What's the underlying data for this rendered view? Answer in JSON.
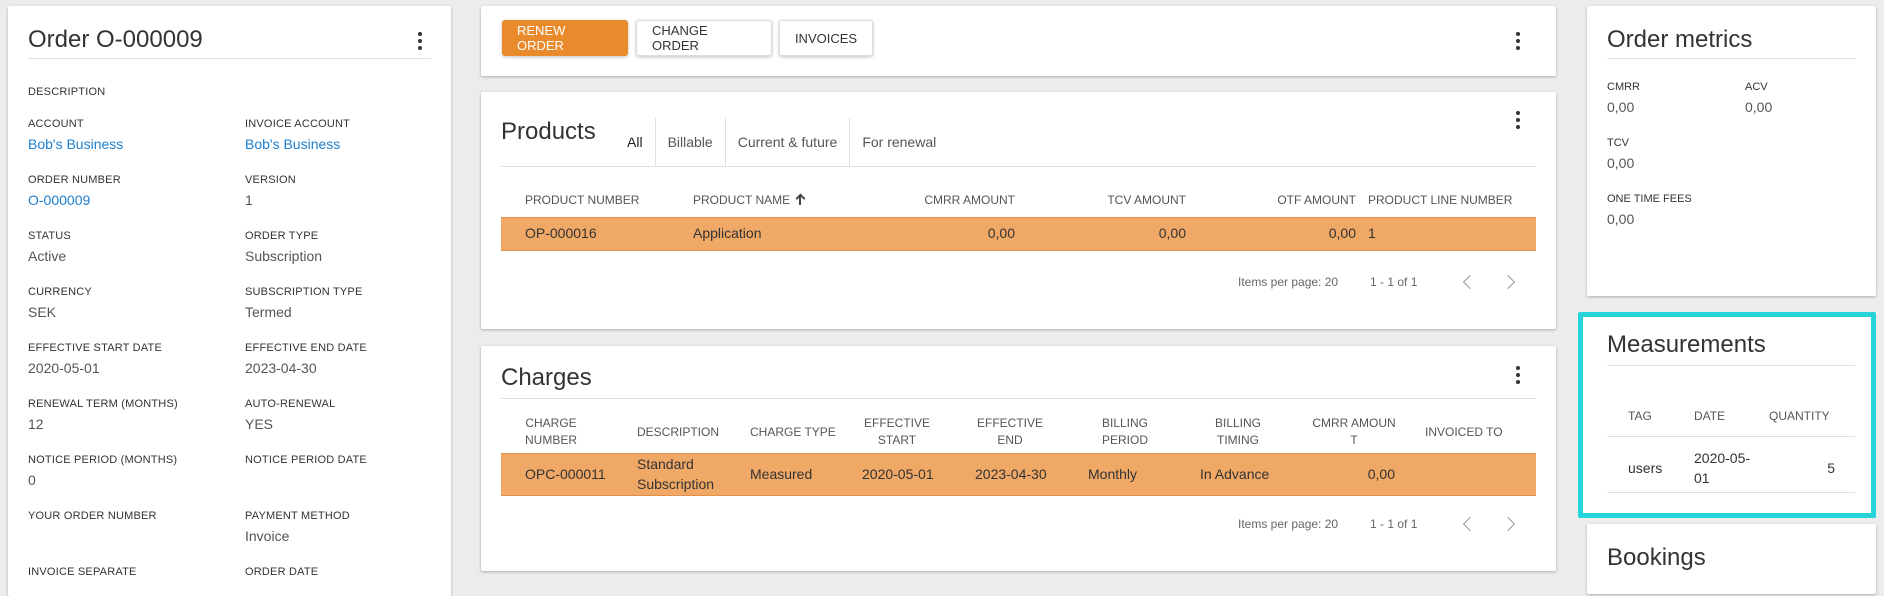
{
  "order": {
    "title": "Order O-000009",
    "fields": {
      "description_label": "DESCRIPTION",
      "account_label": "ACCOUNT",
      "account_value": "Bob's Business",
      "invoice_account_label": "INVOICE ACCOUNT",
      "invoice_account_value": "Bob's Business",
      "order_number_label": "ORDER NUMBER",
      "order_number_value": "O-000009",
      "version_label": "VERSION",
      "version_value": "1",
      "status_label": "STATUS",
      "status_value": "Active",
      "order_type_label": "ORDER TYPE",
      "order_type_value": "Subscription",
      "currency_label": "CURRENCY",
      "currency_value": "SEK",
      "subscription_type_label": "SUBSCRIPTION TYPE",
      "subscription_type_value": "Termed",
      "effective_start_label": "EFFECTIVE START DATE",
      "effective_start_value": "2020-05-01",
      "effective_end_label": "EFFECTIVE END DATE",
      "effective_end_value": "2023-04-30",
      "renewal_term_label": "RENEWAL TERM (MONTHS)",
      "renewal_term_value": "12",
      "auto_renewal_label": "AUTO-RENEWAL",
      "auto_renewal_value": "YES",
      "notice_period_label": "NOTICE PERIOD (MONTHS)",
      "notice_period_value": "0",
      "notice_period_date_label": "NOTICE PERIOD DATE",
      "your_order_number_label": "YOUR ORDER NUMBER",
      "payment_method_label": "PAYMENT METHOD",
      "payment_method_value": "Invoice",
      "invoice_separate_label": "INVOICE SEPARATE",
      "order_date_label": "ORDER DATE"
    }
  },
  "toolbar": {
    "renew_label": "RENEW ORDER",
    "change_label": "CHANGE ORDER",
    "invoices_label": "INVOICES"
  },
  "products": {
    "title": "Products",
    "tabs": [
      "All",
      "Billable",
      "Current & future",
      "For renewal"
    ],
    "columns": [
      "PRODUCT NUMBER",
      "PRODUCT NAME",
      "CMRR AMOUNT",
      "TCV AMOUNT",
      "OTF AMOUNT",
      "PRODUCT LINE NUMBER"
    ],
    "row": [
      "OP-000016",
      "Application",
      "0,00",
      "0,00",
      "0,00",
      "1"
    ],
    "items_per_page": "Items per page: 20",
    "range": "1 - 1 of 1"
  },
  "charges": {
    "title": "Charges",
    "columns": {
      "c1a": "CHARGE",
      "c1b": "NUMBER",
      "c2": "DESCRIPTION",
      "c3": "CHARGE TYPE",
      "c4a": "EFFECTIVE",
      "c4b": "START",
      "c5a": "EFFECTIVE",
      "c5b": "END",
      "c6a": "BILLING",
      "c6b": "PERIOD",
      "c7a": "BILLING",
      "c7b": "TIMING",
      "c8a": "CMRR AMOUN",
      "c8b": "T",
      "c9": "INVOICED TO"
    },
    "row": {
      "number": "OPC-000011",
      "desc_a": "Standard",
      "desc_b": "Subscription",
      "type": "Measured",
      "start": "2020-05-01",
      "end": "2023-04-30",
      "period": "Monthly",
      "timing": "In Advance",
      "cmrr": "0,00"
    },
    "items_per_page": "Items per page: 20",
    "range": "1 - 1 of 1"
  },
  "metrics": {
    "title": "Order metrics",
    "cmrr_label": "CMRR",
    "cmrr_value": "0,00",
    "acv_label": "ACV",
    "acv_value": "0,00",
    "tcv_label": "TCV",
    "tcv_value": "0,00",
    "otf_label": "ONE TIME FEES",
    "otf_value": "0,00"
  },
  "measurements": {
    "title": "Measurements",
    "columns": [
      "TAG",
      "DATE",
      "QUANTITY"
    ],
    "row": {
      "tag": "users",
      "date_a": "2020-05-",
      "date_b": "01",
      "quantity": "5"
    },
    "highlight_color": "#26d3d8"
  },
  "bookings": {
    "title": "Bookings"
  },
  "colors": {
    "accent": "#e98a2c",
    "row_highlight": "#f0a866",
    "link": "#1e7fd0"
  }
}
